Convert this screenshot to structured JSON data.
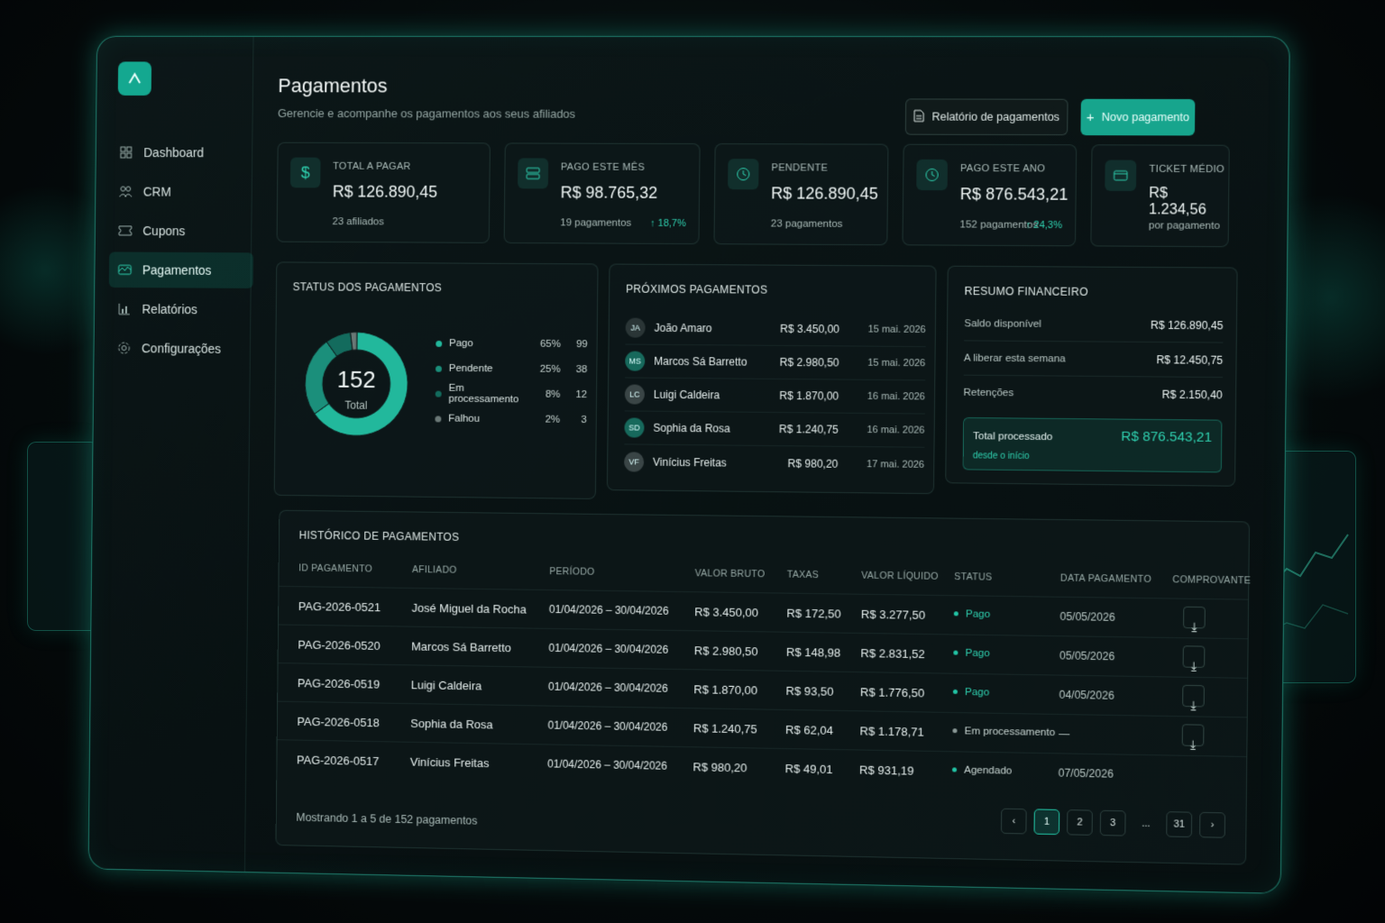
{
  "sidebar": {
    "items": [
      {
        "label": "Dashboard",
        "icon": "dashboard-icon"
      },
      {
        "label": "CRM",
        "icon": "users-icon"
      },
      {
        "label": "Cupons",
        "icon": "ticket-icon"
      },
      {
        "label": "Pagamentos",
        "icon": "wallet-icon",
        "active": true
      },
      {
        "label": "Relatórios",
        "icon": "bar-chart-icon"
      },
      {
        "label": "Configurações",
        "icon": "gear-icon"
      }
    ]
  },
  "header": {
    "title": "Pagamentos",
    "subtitle": "Gerencie e acompanhe os pagamentos aos seus afiliados",
    "report_button": "Relatório de pagamentos",
    "new_button": "Novo pagamento"
  },
  "stats": [
    {
      "label": "TOTAL A PAGAR",
      "value": "R$ 126.890,45",
      "sub": "23 afiliados",
      "trend": ""
    },
    {
      "label": "PAGO ESTE MÊS",
      "value": "R$ 98.765,32",
      "sub": "19 pagamentos",
      "trend": "↑ 18,7%"
    },
    {
      "label": "PENDENTE",
      "value": "R$ 126.890,45",
      "sub": "23 pagamentos",
      "trend": ""
    },
    {
      "label": "PAGO ESTE ANO",
      "value": "R$ 876.543,21",
      "sub": "152 pagamentos",
      "trend": "↑ 24,3%"
    },
    {
      "label": "TICKET MÉDIO",
      "value": "R$ 1.234,56",
      "sub": "por pagamento",
      "trend": ""
    }
  ],
  "status_card": {
    "title": "STATUS DOS PAGAMENTOS",
    "center_value": "152",
    "center_label": "Total",
    "items": [
      {
        "label": "Pago",
        "pct": "65%",
        "count": "99",
        "share": 0.65,
        "color": "#22b89c"
      },
      {
        "label": "Pendente",
        "pct": "25%",
        "count": "38",
        "share": 0.25,
        "color": "#1b8f7b"
      },
      {
        "label": "Em processamento",
        "pct": "8%",
        "count": "12",
        "share": 0.08,
        "color": "#136b5d"
      },
      {
        "label": "Falhou",
        "pct": "2%",
        "count": "3",
        "share": 0.02,
        "color": "#6a7876"
      }
    ]
  },
  "upcoming": {
    "title": "PRÓXIMOS PAGAMENTOS",
    "rows": [
      {
        "initials": "JA",
        "name": "João Amaro",
        "amount": "R$ 3.450,00",
        "date": "15 mai. 2026",
        "color": "#2a3536"
      },
      {
        "initials": "MS",
        "name": "Marcos Sá Barretto",
        "amount": "R$ 2.980,50",
        "date": "15 mai. 2026",
        "color": "#17695c"
      },
      {
        "initials": "LC",
        "name": "Luigi Caldeira",
        "amount": "R$ 1.870,00",
        "date": "16 mai. 2026",
        "color": "#3a4546"
      },
      {
        "initials": "SD",
        "name": "Sophia da Rosa",
        "amount": "R$ 1.240,75",
        "date": "16 mai. 2026",
        "color": "#17695c"
      },
      {
        "initials": "VF",
        "name": "Vinícius Freitas",
        "amount": "R$ 980,20",
        "date": "17 mai. 2026",
        "color": "#3a4546"
      }
    ]
  },
  "summary": {
    "title": "RESUMO FINANCEIRO",
    "rows": [
      {
        "label": "Saldo disponível",
        "value": "R$ 126.890,45"
      },
      {
        "label": "A liberar esta semana",
        "value": "R$ 12.450,75"
      },
      {
        "label": "Retenções",
        "value": "R$ 2.150,40"
      }
    ],
    "total_label": "Total processado",
    "total_value": "R$ 876.543,21",
    "total_sub": "desde o início"
  },
  "history": {
    "title": "HISTÓRICO DE PAGAMENTOS",
    "columns": [
      "ID PAGAMENTO",
      "AFILIADO",
      "PERÍODO",
      "VALOR BRUTO",
      "TAXAS",
      "VALOR LÍQUIDO",
      "STATUS",
      "DATA PAGAMENTO",
      "COMPROVANTE"
    ],
    "rows": [
      {
        "id": "PAG-2026-0521",
        "affiliate": "José Miguel da Rocha",
        "period": "01/04/2026 – 30/04/2026",
        "gross": "R$ 3.450,00",
        "fees": "R$ 172,50",
        "net": "R$ 3.277,50",
        "status": "Pago",
        "paid_date": "05/05/2026",
        "status_color": "#22c4a5"
      },
      {
        "id": "PAG-2026-0520",
        "affiliate": "Marcos Sá Barretto",
        "period": "01/04/2026 – 30/04/2026",
        "gross": "R$ 2.980,50",
        "fees": "R$ 148,98",
        "net": "R$ 2.831,52",
        "status": "Pago",
        "paid_date": "05/05/2026",
        "status_color": "#22c4a5"
      },
      {
        "id": "PAG-2026-0519",
        "affiliate": "Luigi Caldeira",
        "period": "01/04/2026 – 30/04/2026",
        "gross": "R$ 1.870,00",
        "fees": "R$ 93,50",
        "net": "R$ 1.776,50",
        "status": "Pago",
        "paid_date": "04/05/2026",
        "status_color": "#22c4a5"
      },
      {
        "id": "PAG-2026-0518",
        "affiliate": "Sophia da Rosa",
        "period": "01/04/2026 – 30/04/2026",
        "gross": "R$ 1.240,75",
        "fees": "R$ 62,04",
        "net": "R$ 1.178,71",
        "status": "Em processamento",
        "paid_date": "—",
        "status_color": "#8a9896"
      },
      {
        "id": "PAG-2026-0517",
        "affiliate": "Vinícius Freitas",
        "period": "01/04/2026 – 30/04/2026",
        "gross": "R$ 980,20",
        "fees": "R$ 49,01",
        "net": "R$ 931,19",
        "status": "Agendado",
        "paid_date": "07/05/2026",
        "status_color": "#22c4a5"
      }
    ],
    "footer": "Mostrando 1 a 5 de 152 pagamentos",
    "pages": [
      "1",
      "2",
      "3",
      "...",
      "31"
    ],
    "current_page": "1"
  }
}
